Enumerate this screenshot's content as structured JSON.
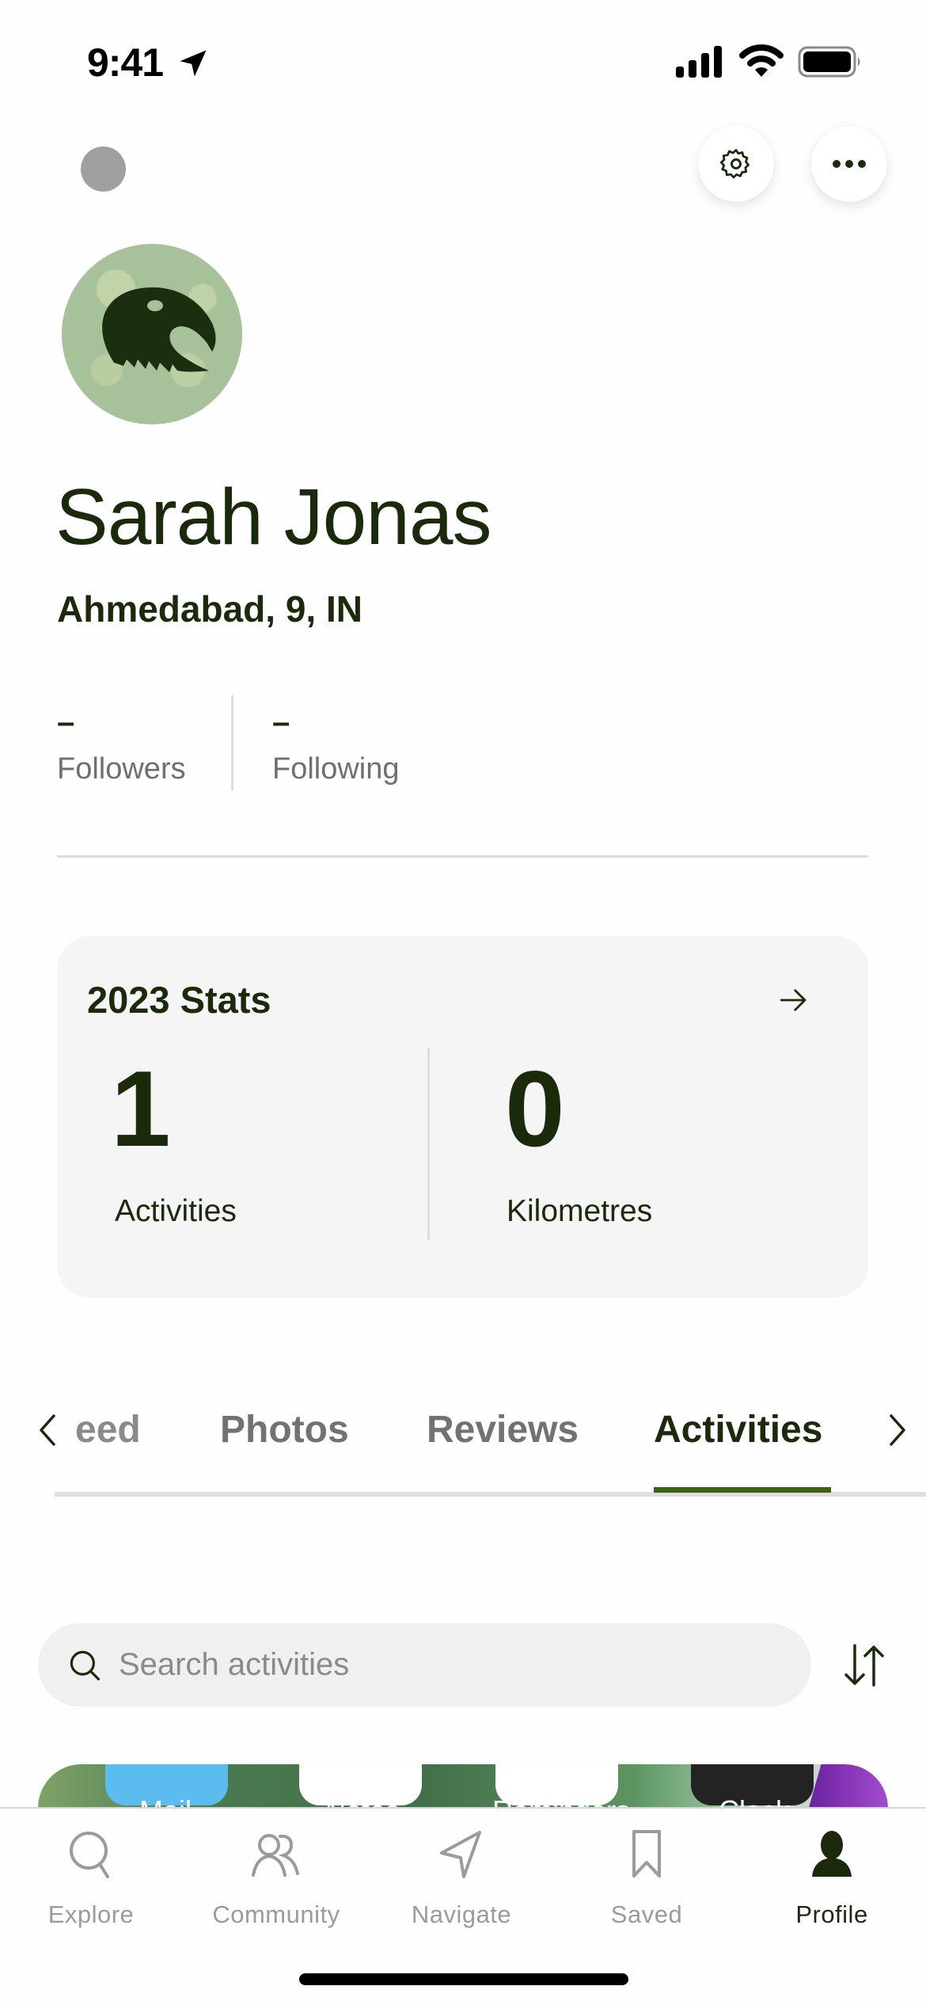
{
  "status_bar": {
    "time": "9:41",
    "icons": [
      "location-arrow-icon",
      "signal-icon",
      "wifi-icon",
      "battery-icon"
    ]
  },
  "header": {
    "actions": [
      {
        "icon": "gear-icon",
        "label": "Settings"
      },
      {
        "icon": "more-icon",
        "label": "More"
      }
    ]
  },
  "profile": {
    "name": "Sarah Jonas",
    "location": "Ahmedabad, 9, IN",
    "followers": {
      "value": "–",
      "label": "Followers"
    },
    "following": {
      "value": "–",
      "label": "Following"
    }
  },
  "stats": {
    "title": "2023 Stats",
    "items": [
      {
        "value": "1",
        "label": "Activities"
      },
      {
        "value": "0",
        "label": "Kilometres"
      }
    ]
  },
  "tabs": {
    "items": [
      {
        "label": "eed",
        "active": false
      },
      {
        "label": "Photos",
        "active": false
      },
      {
        "label": "Reviews",
        "active": false
      },
      {
        "label": "Activities",
        "active": true
      }
    ]
  },
  "search": {
    "placeholder": "Search activities",
    "value": ""
  },
  "activity_thumbnail": {
    "app_labels": [
      "Mail",
      "Notes",
      "Reminders",
      "Clock"
    ]
  },
  "bottom_nav": {
    "items": [
      {
        "label": "Explore",
        "icon": "search-icon",
        "active": false
      },
      {
        "label": "Community",
        "icon": "community-icon",
        "active": false
      },
      {
        "label": "Navigate",
        "icon": "navigate-icon",
        "active": false
      },
      {
        "label": "Saved",
        "icon": "bookmark-icon",
        "active": false
      },
      {
        "label": "Profile",
        "icon": "profile-icon",
        "active": true
      }
    ]
  },
  "colors": {
    "primary_text": "#1c2a0c",
    "accent": "#3e6215",
    "muted": "#727272",
    "card_bg": "#f6f5f5"
  }
}
